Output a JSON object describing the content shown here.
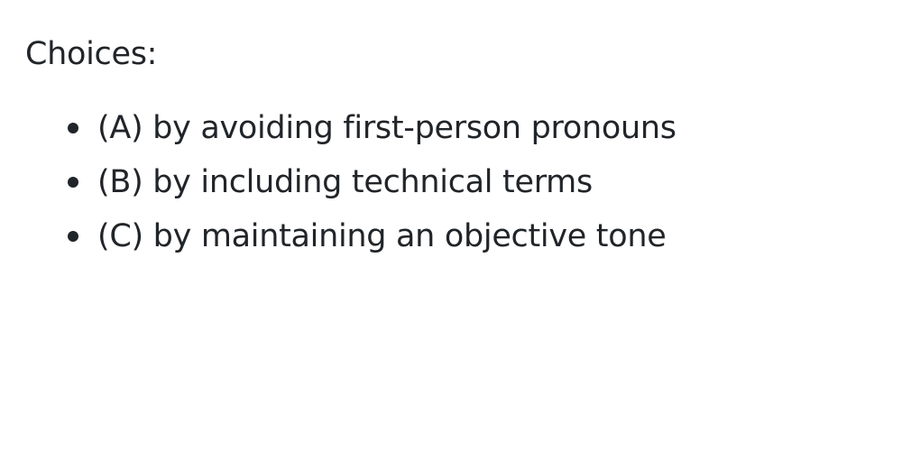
{
  "heading": "Choices:",
  "choices": [
    {
      "label": "(A) by avoiding first-person pronouns"
    },
    {
      "label": "(B) by including technical terms"
    },
    {
      "label": "(C) by maintaining an objective tone"
    }
  ],
  "colors": {
    "text": "#212529",
    "background": "#ffffff"
  }
}
